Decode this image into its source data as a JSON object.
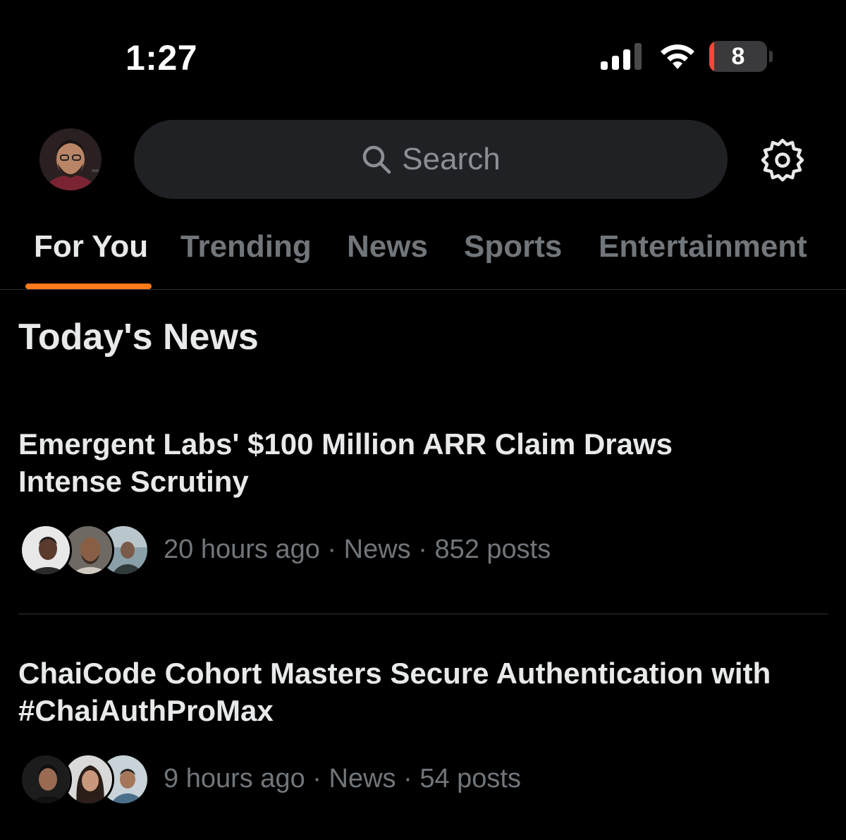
{
  "status_bar": {
    "time": "1:27",
    "battery_level": "8",
    "battery_fraction": 0.08,
    "battery_color": "#ff453a"
  },
  "header": {
    "avatar_icon": "profile-avatar",
    "search": {
      "placeholder": "Search",
      "icon": "search-icon"
    },
    "settings_icon": "gear-icon"
  },
  "tabs": [
    {
      "label": "For You",
      "active": true
    },
    {
      "label": "Trending",
      "active": false
    },
    {
      "label": "News",
      "active": false
    },
    {
      "label": "Sports",
      "active": false
    },
    {
      "label": "Entertainment",
      "active": false
    }
  ],
  "accent_color": "#ff7a1a",
  "section": {
    "title": "Today's News"
  },
  "news": [
    {
      "headline_lines": [
        "Emergent Labs' $100 Million ARR Claim Draws",
        "Intense Scrutiny"
      ],
      "time": "20 hours ago",
      "category": "News",
      "posts": "852 posts",
      "separator": " · "
    },
    {
      "headline_lines": [
        "ChaiCode Cohort Masters Secure Authentication with",
        "#ChaiAuthProMax"
      ],
      "time": "9 hours ago",
      "category": "News",
      "posts": "54 posts",
      "separator": " · "
    }
  ]
}
